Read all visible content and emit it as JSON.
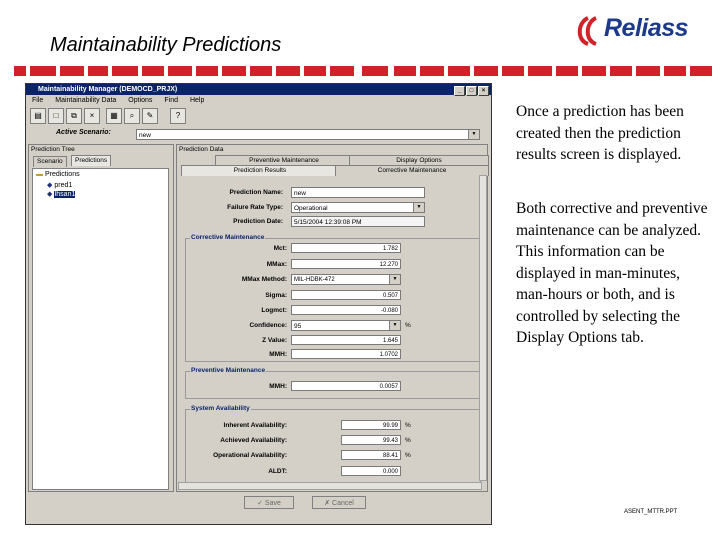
{
  "slide": {
    "title": "Maintainability Predictions",
    "logo_text": "Reliass",
    "paragraph1": "Once a prediction has been created then the prediction results screen is displayed.",
    "paragraph2": "Both corrective and preventive maintenance can be analyzed. This information can be displayed in man-minutes, man-hours or both, and is controlled by selecting the Display Options tab.",
    "footer": "ASENT_MTTR.PPT",
    "accent_color": "#d12229"
  },
  "window": {
    "title": "Maintainability Manager (DEMOCD_PRJX)",
    "menu": [
      "File",
      "Maintainability Data",
      "Options",
      "Find",
      "Help"
    ],
    "active_scenario_label": "Active Scenario:",
    "active_scenario_value": "new"
  },
  "tree": {
    "header": "Prediction Tree",
    "tabs": [
      "Scenario",
      "Predictions"
    ],
    "root": "Predictions",
    "items": [
      "pred1",
      "Ihsan1"
    ]
  },
  "detail": {
    "header": "Prediction Data",
    "tabs": [
      "Preventive Maintenance",
      "Display Options",
      "Prediction Results",
      "Corrective Maintenance"
    ],
    "prediction_name_label": "Prediction Name:",
    "prediction_name": "new",
    "failure_rate_type_label": "Failure Rate Type:",
    "failure_rate_type": "Operational",
    "prediction_date_label": "Prediction Date:",
    "prediction_date": "5/15/2004 12:39:08 PM"
  },
  "corrective": {
    "title": "Corrective Maintenance",
    "rows": [
      {
        "label": "Mct:",
        "value": "1.782",
        "unit": ""
      },
      {
        "label": "MMax:",
        "value": "12.270",
        "unit": ""
      },
      {
        "label": "MMax Method:",
        "value": "MIL-HDBK-472",
        "unit": ""
      },
      {
        "label": "Sigma:",
        "value": "0.507",
        "unit": ""
      },
      {
        "label": "Logmct:",
        "value": "-0.080",
        "unit": ""
      },
      {
        "label": "Confidence:",
        "value": "95",
        "unit": "%"
      },
      {
        "label": "Z Value:",
        "value": "1.645",
        "unit": ""
      },
      {
        "label": "MMH:",
        "value": "1.0702",
        "unit": ""
      }
    ]
  },
  "preventive": {
    "title": "Preventive Maintenance",
    "mmh_label": "MMH:",
    "mmh_value": "0.0057"
  },
  "availability": {
    "title": "System Availability",
    "rows": [
      {
        "label": "Inherent Availability:",
        "value": "99.99",
        "unit": "%"
      },
      {
        "label": "Achieved Availability:",
        "value": "99.43",
        "unit": "%"
      },
      {
        "label": "Operational Availability:",
        "value": "88.41",
        "unit": "%"
      },
      {
        "label": "ALDT:",
        "value": "0.000",
        "unit": ""
      }
    ]
  },
  "buttons": {
    "save": "Save",
    "cancel": "Cancel"
  }
}
